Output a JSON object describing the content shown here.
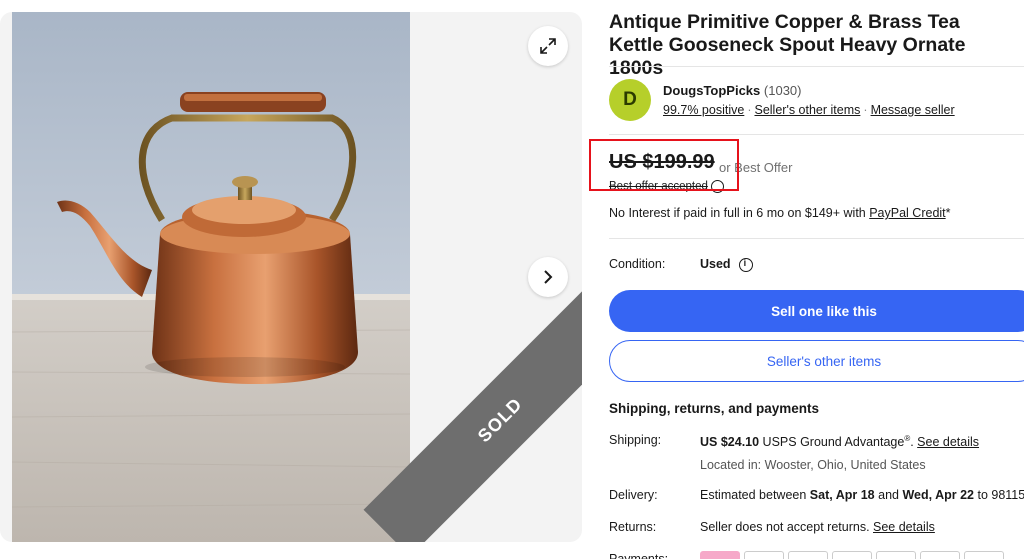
{
  "gallery": {
    "expand_icon": "expand-arrows-icon",
    "next_icon": "chevron-right-icon",
    "ribbon_text": "SOLD"
  },
  "listing": {
    "title": "Antique Primitive Copper & Brass Tea Kettle Gooseneck Spout Heavy Ornate 1800s"
  },
  "seller": {
    "avatar_letter": "D",
    "name": "DougsTopPicks",
    "feedback_count": "(1030)",
    "positive": "99.7% positive",
    "other_items_link": "Seller's other items",
    "message_link": "Message seller"
  },
  "price": {
    "amount": "US $199.99",
    "best_offer": "or Best Offer",
    "offer_accepted": "Best offer accepted"
  },
  "financing": {
    "text": "No Interest if paid in full in 6 mo on $149+ with ",
    "link": "PayPal Credit",
    "suffix": "*"
  },
  "condition": {
    "label": "Condition:",
    "value": "Used"
  },
  "buttons": {
    "sell_one": "Sell one like this",
    "other_items": "Seller's other items"
  },
  "shipping_section": {
    "title": "Shipping, returns, and payments",
    "shipping_label": "Shipping:",
    "shipping_price": "US $24.10",
    "shipping_service": " USPS Ground Advantage",
    "shipping_reg": "®",
    "shipping_link": "See details",
    "location": "Located in: Wooster, Ohio, United States",
    "delivery_label": "Delivery:",
    "delivery_prefix": "Estimated between ",
    "delivery_start": "Sat, Apr 18",
    "delivery_and": " and ",
    "delivery_end": "Wed, Apr 22",
    "delivery_suffix": " to 98115",
    "returns_label": "Returns:",
    "returns_text": "Seller does not accept returns. ",
    "returns_link": "See details",
    "payments_label": "Payments:"
  },
  "colors": {
    "accent": "#3665f3",
    "highlight": "#e6121b",
    "avatar": "#b6cf2a",
    "sold_ribbon": "#6e6e6e"
  }
}
